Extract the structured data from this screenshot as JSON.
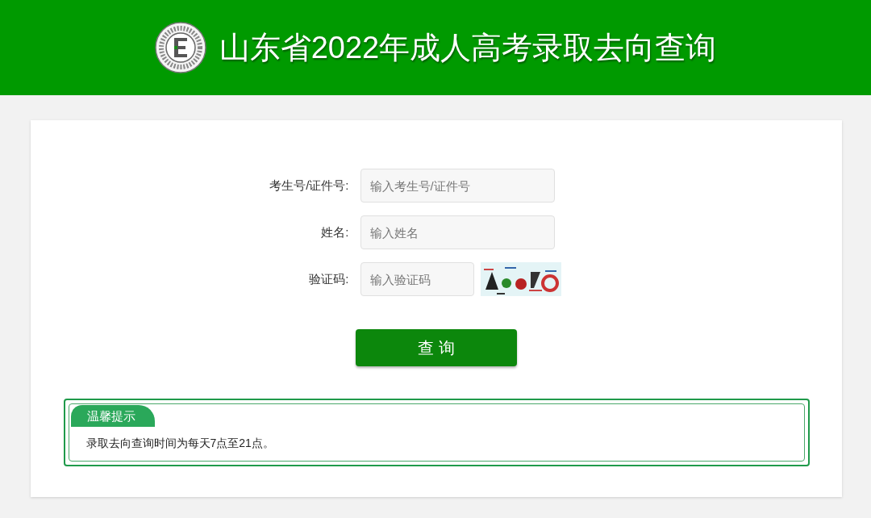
{
  "header": {
    "title": "山东省2022年成人高考录取去向查询"
  },
  "form": {
    "fields": [
      {
        "kind": "text",
        "label": "考生号/证件号:",
        "placeholder": "输入考生号/证件号"
      },
      {
        "kind": "text",
        "label": "姓名:",
        "placeholder": "输入姓名"
      },
      {
        "kind": "captcha",
        "label": "验证码:",
        "placeholder": "输入验证码"
      }
    ],
    "submit": "查 询"
  },
  "notice": {
    "tag": "温馨提示",
    "text": "录取去向查询时间为每天7点至21点。"
  }
}
